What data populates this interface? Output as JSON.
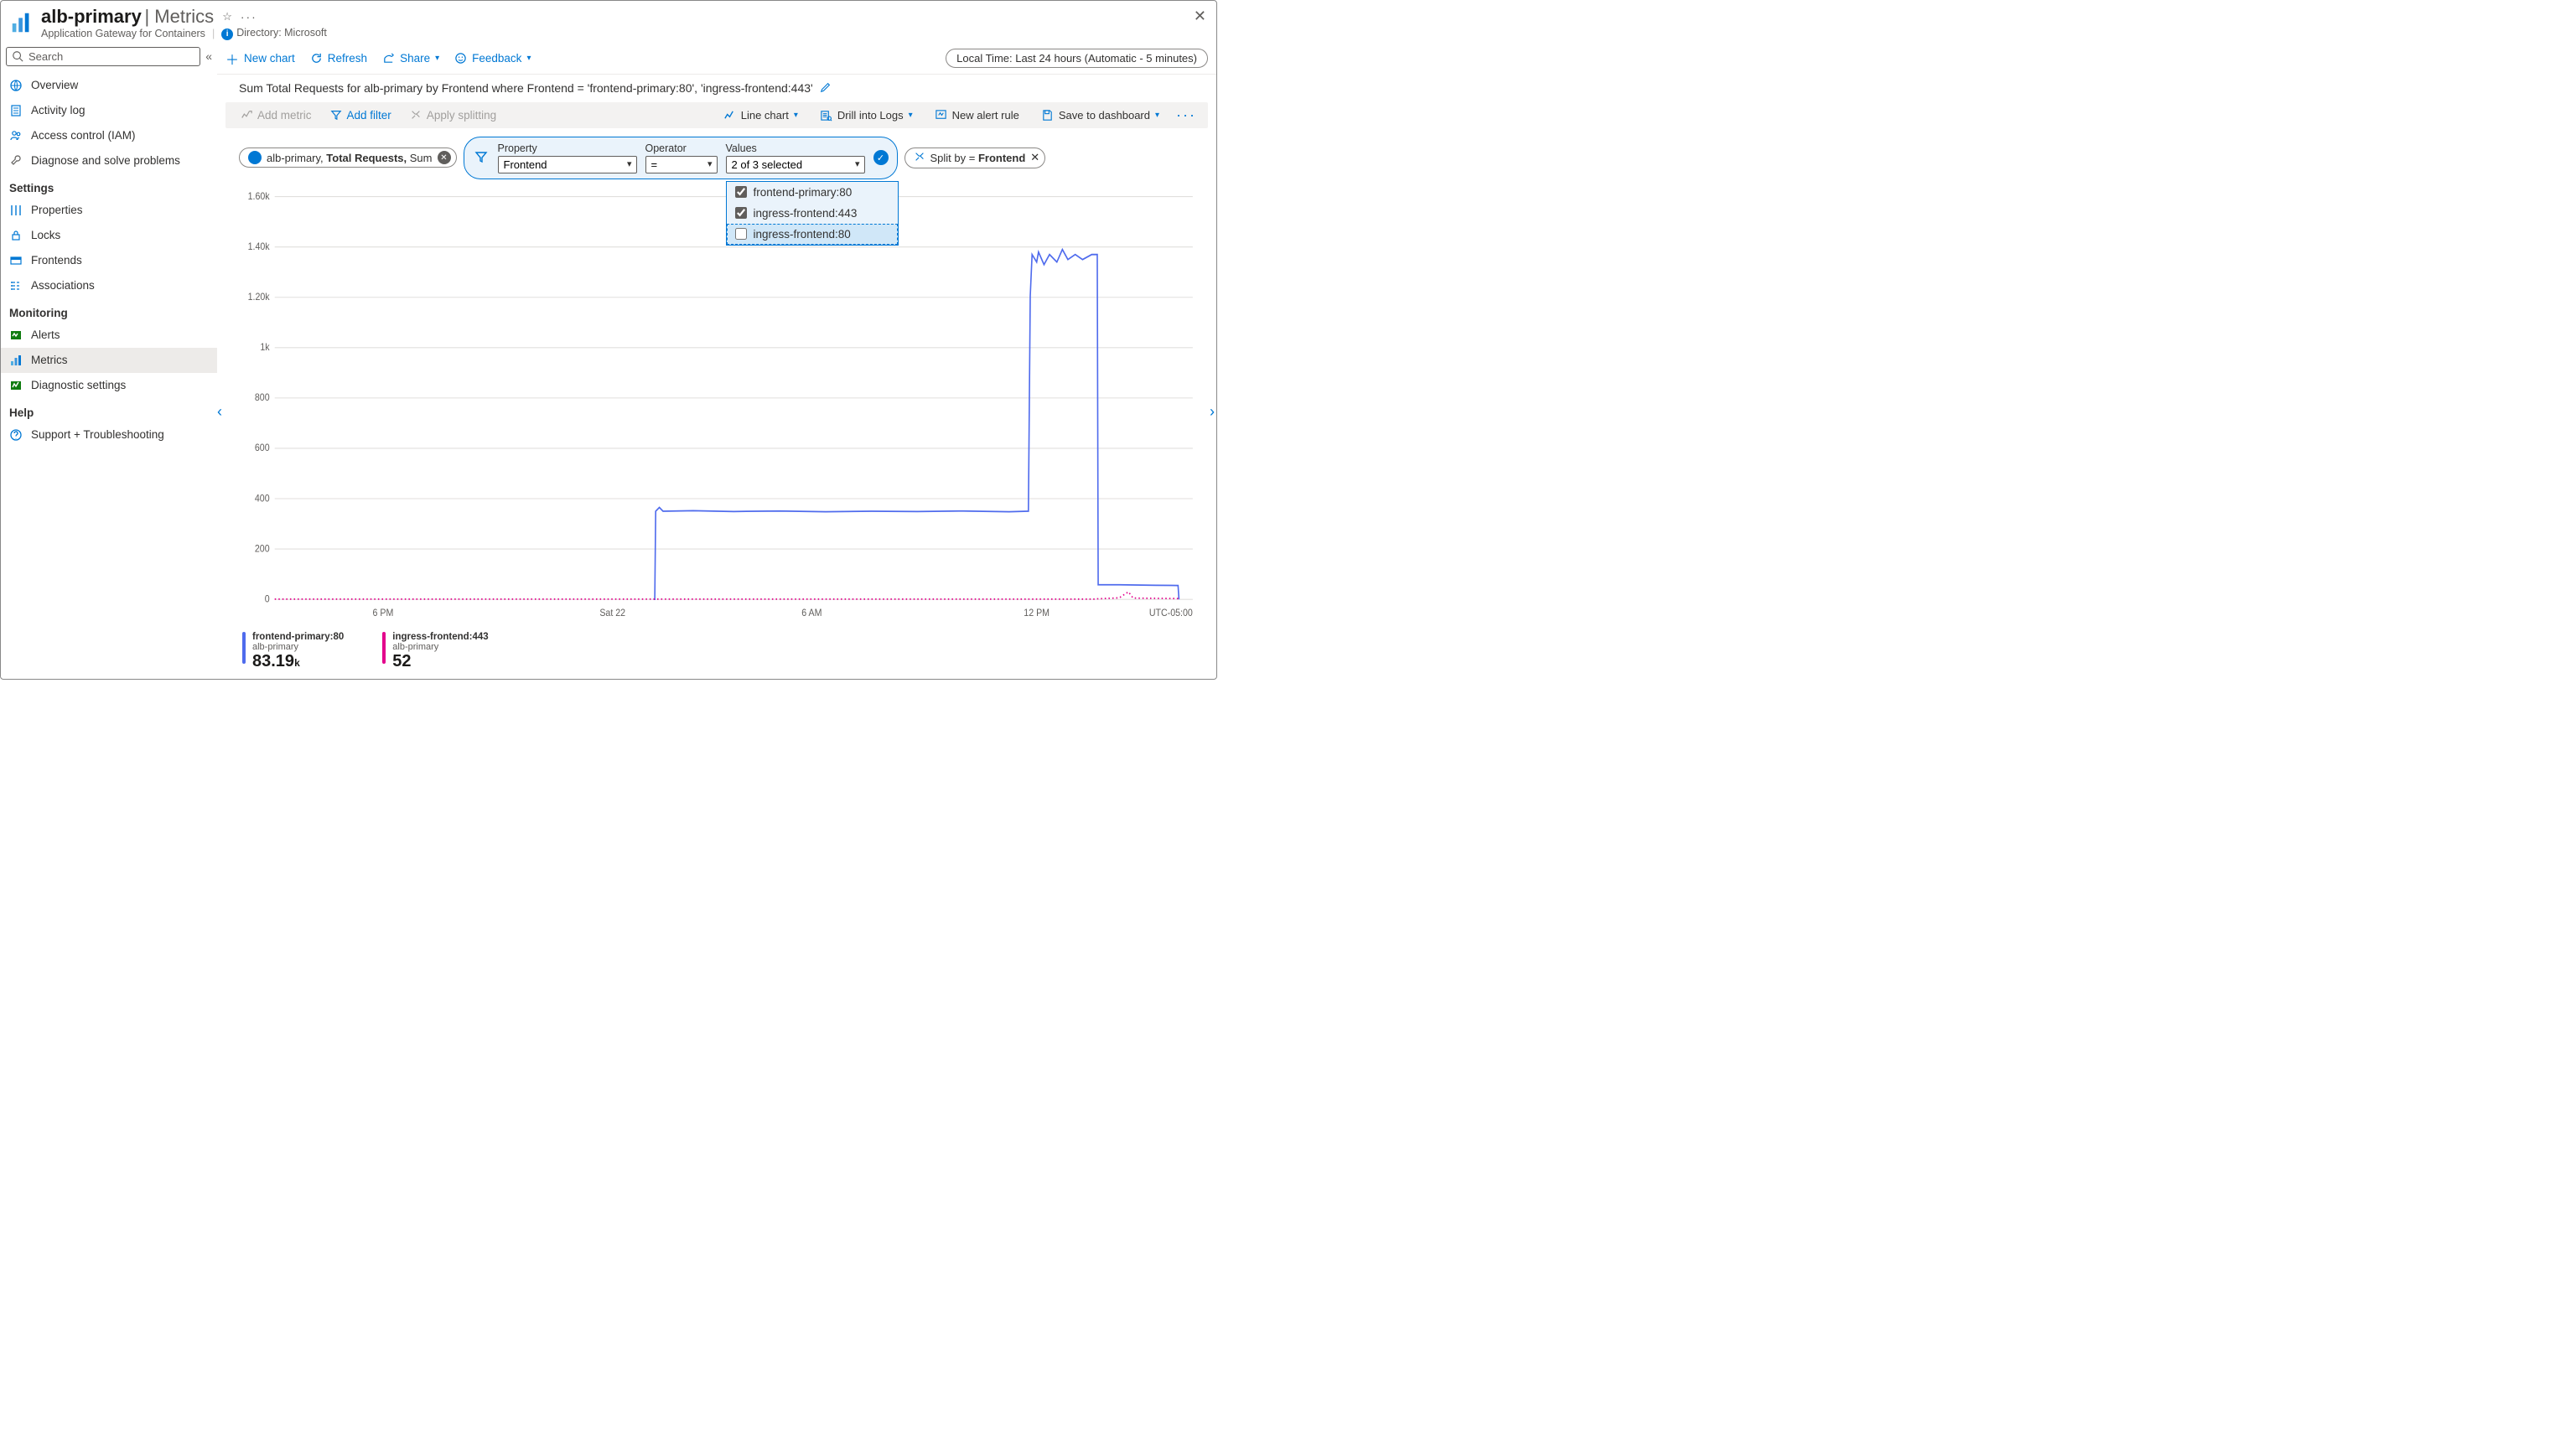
{
  "header": {
    "title_main": "alb-primary",
    "title_sep": "|",
    "title_sub": "Metrics",
    "subtitle_left": "Application Gateway for Containers",
    "subtitle_right": "Directory: Microsoft"
  },
  "sidebar": {
    "search_placeholder": "Search",
    "items_top": [
      {
        "label": "Overview",
        "icon": "globe"
      },
      {
        "label": "Activity log",
        "icon": "log"
      },
      {
        "label": "Access control (IAM)",
        "icon": "people"
      },
      {
        "label": "Diagnose and solve problems",
        "icon": "wrench"
      }
    ],
    "sections": [
      {
        "title": "Settings",
        "items": [
          {
            "label": "Properties",
            "icon": "sliders"
          },
          {
            "label": "Locks",
            "icon": "lock"
          },
          {
            "label": "Frontends",
            "icon": "frontends"
          },
          {
            "label": "Associations",
            "icon": "assoc"
          }
        ]
      },
      {
        "title": "Monitoring",
        "items": [
          {
            "label": "Alerts",
            "icon": "alerts"
          },
          {
            "label": "Metrics",
            "icon": "metrics",
            "active": true
          },
          {
            "label": "Diagnostic settings",
            "icon": "diag"
          }
        ]
      },
      {
        "title": "Help",
        "items": [
          {
            "label": "Support + Troubleshooting",
            "icon": "support"
          }
        ]
      }
    ]
  },
  "toolbar1": {
    "new_chart": "New chart",
    "refresh": "Refresh",
    "share": "Share",
    "feedback": "Feedback",
    "time": "Local Time: Last 24 hours (Automatic - 5 minutes)"
  },
  "chart_subtitle": "Sum Total Requests for alb-primary by Frontend where Frontend = 'frontend-primary:80', 'ingress-frontend:443'",
  "toolbar2": {
    "add_metric": "Add metric",
    "add_filter": "Add filter",
    "apply_splitting": "Apply splitting",
    "line_chart": "Line chart",
    "drill": "Drill into Logs",
    "new_alert": "New alert rule",
    "save": "Save to dashboard"
  },
  "metric_chip": {
    "resource": "alb-primary,",
    "metric": "Total Requests,",
    "agg": "Sum"
  },
  "filter": {
    "property_label": "Property",
    "property_value": "Frontend",
    "operator_label": "Operator",
    "operator_value": "=",
    "values_label": "Values",
    "values_summary": "2 of 3 selected",
    "options": [
      {
        "label": "frontend-primary:80",
        "checked": true
      },
      {
        "label": "ingress-frontend:443",
        "checked": true
      },
      {
        "label": "ingress-frontend:80",
        "checked": false
      }
    ]
  },
  "split_chip": {
    "prefix": "Split by =",
    "value": "Frontend"
  },
  "legend": [
    {
      "color": "#4f6bed",
      "title": "frontend-primary:80",
      "sub": "alb-primary",
      "value": "83.19",
      "unit": "k"
    },
    {
      "color": "#e3008c",
      "title": "ingress-frontend:443",
      "sub": "alb-primary",
      "value": "52",
      "unit": ""
    }
  ],
  "chart_data": {
    "type": "line",
    "xlabel": "",
    "ylabel": "",
    "ylim": [
      0,
      1600
    ],
    "y_ticks": [
      0,
      200,
      400,
      600,
      800,
      1000,
      1200,
      1400,
      1600
    ],
    "y_tick_labels": [
      "0",
      "200",
      "400",
      "600",
      "800",
      "1k",
      "1.20k",
      "1.40k",
      "1.60k"
    ],
    "x_ticks": [
      0.118,
      0.368,
      0.585,
      0.83
    ],
    "x_tick_labels": [
      "6 PM",
      "Sat 22",
      "6 AM",
      "12 PM"
    ],
    "tz_label": "UTC-05:00",
    "series": [
      {
        "name": "frontend-primary:80",
        "color": "#4f6bed",
        "style": "solid",
        "points": [
          [
            0.413,
            0
          ],
          [
            0.414,
            0
          ],
          [
            0.415,
            350
          ],
          [
            0.419,
            365
          ],
          [
            0.423,
            350
          ],
          [
            0.456,
            352
          ],
          [
            0.5,
            349
          ],
          [
            0.55,
            351
          ],
          [
            0.6,
            348
          ],
          [
            0.65,
            350
          ],
          [
            0.7,
            349
          ],
          [
            0.75,
            351
          ],
          [
            0.8,
            348
          ],
          [
            0.82,
            350
          ],
          [
            0.821,
            350
          ],
          [
            0.823,
            1205
          ],
          [
            0.825,
            1370
          ],
          [
            0.83,
            1340
          ],
          [
            0.832,
            1380
          ],
          [
            0.838,
            1330
          ],
          [
            0.844,
            1370
          ],
          [
            0.852,
            1340
          ],
          [
            0.858,
            1390
          ],
          [
            0.864,
            1350
          ],
          [
            0.872,
            1370
          ],
          [
            0.88,
            1350
          ],
          [
            0.89,
            1370
          ],
          [
            0.895,
            1370
          ],
          [
            0.896,
            1370
          ],
          [
            0.897,
            58
          ],
          [
            0.92,
            58
          ],
          [
            0.96,
            56
          ],
          [
            0.984,
            55
          ],
          [
            0.985,
            0
          ]
        ]
      },
      {
        "name": "ingress-frontend:443",
        "color": "#e3008c",
        "style": "dotted",
        "points": [
          [
            0.0,
            1
          ],
          [
            0.1,
            1
          ],
          [
            0.2,
            1
          ],
          [
            0.3,
            1
          ],
          [
            0.4,
            1
          ],
          [
            0.5,
            1
          ],
          [
            0.6,
            1
          ],
          [
            0.7,
            1
          ],
          [
            0.8,
            1
          ],
          [
            0.895,
            1
          ],
          [
            0.896,
            2
          ],
          [
            0.92,
            6
          ],
          [
            0.93,
            30
          ],
          [
            0.935,
            5
          ],
          [
            0.96,
            4
          ],
          [
            0.984,
            3
          ],
          [
            0.985,
            0
          ]
        ]
      }
    ]
  }
}
